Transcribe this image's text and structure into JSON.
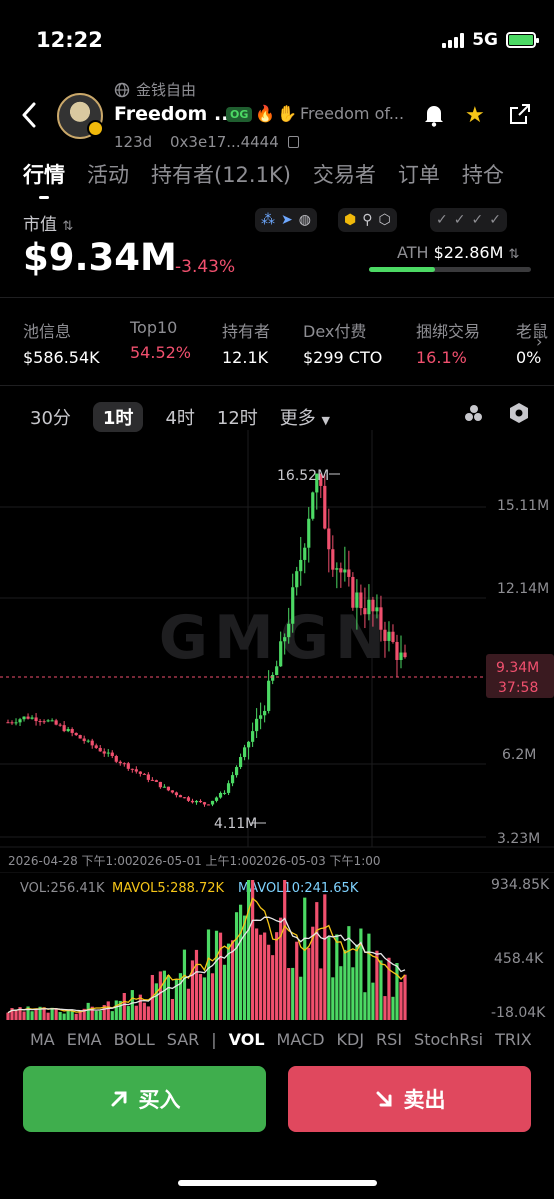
{
  "status_bar": {
    "time": "12:22",
    "network": "5G"
  },
  "header": {
    "sub_label": "金钱自由",
    "token_name": "Freedom ...",
    "og_badge": "OG",
    "description": "Freedom of...",
    "age": "123d",
    "address": "0x3e17...4444"
  },
  "tabs": [
    "行情",
    "活动",
    "持有者(12.1K)",
    "交易者",
    "订单",
    "持仓"
  ],
  "market": {
    "label": "市值",
    "value": "$9.34M",
    "change": "-3.43%",
    "ath_label": "ATH",
    "ath_value": "$22.86M",
    "ath_progress": 0.41
  },
  "stats": [
    {
      "key": "池信息",
      "value": "$586.54K",
      "color": "#ffffff"
    },
    {
      "key": "Top10",
      "value": "54.52%",
      "color": "#f0506e"
    },
    {
      "key": "持有者",
      "value": "12.1K",
      "color": "#ffffff"
    },
    {
      "key": "Dex付费",
      "value": "$299 CTO",
      "color": "#ffffff"
    },
    {
      "key": "捆绑交易",
      "value": "16.1%",
      "color": "#f0506e"
    },
    {
      "key": "老鼠",
      "value": "0%",
      "color": "#ffffff"
    }
  ],
  "intervals": [
    "30分",
    "1时",
    "4时",
    "12时",
    "更多"
  ],
  "price_chart": {
    "high_label": "16.52M",
    "low_label": "4.11M",
    "y_ticks": [
      "15.11M",
      "12.14M",
      "9.34M",
      "6.2M",
      "3.23M"
    ],
    "current_price": "9.34M",
    "countdown": "37:58",
    "x_labels": [
      "2026-04-28 下午1:00",
      "2026-05-01 上午1:00",
      "2026-05-03 下午1:00"
    ],
    "watermark": "GMGN"
  },
  "volume_chart": {
    "vol": "VOL:256.41K",
    "mavol5": "MAVOL5:288.72K",
    "mavol10": "MAVOL10:241.65K",
    "y_ticks": [
      "934.85K",
      "458.4K",
      "-18.04K"
    ]
  },
  "indicators": [
    "MA",
    "EMA",
    "BOLL",
    "SAR",
    "VOL",
    "MACD",
    "KDJ",
    "RSI",
    "StochRsi",
    "TRIX"
  ],
  "buttons": {
    "buy": "买入",
    "sell": "卖出"
  },
  "colors": {
    "up": "#4cd964",
    "down": "#f0506e",
    "buy": "#3fae4d",
    "sell": "#e0485e"
  },
  "chart_data": {
    "type": "candlestick",
    "ylim": [
      3.23,
      16.52
    ],
    "x": [
      "2026-04-28 下午1:00",
      "2026-05-01 上午1:00",
      "2026-05-03 下午1:00"
    ],
    "close_trend_millions": [
      7.2,
      7.4,
      7.3,
      7.0,
      6.6,
      6.2,
      5.8,
      5.4,
      5.0,
      4.6,
      4.3,
      4.11,
      4.6,
      6.0,
      7.5,
      9.5,
      12.5,
      16.52,
      13.5,
      12.0,
      11.5,
      10.5,
      9.34
    ],
    "volume_trend_k": [
      40,
      50,
      45,
      60,
      80,
      120,
      200,
      300,
      400,
      520,
      680,
      934.85,
      600,
      500,
      420,
      350,
      256.41
    ]
  }
}
